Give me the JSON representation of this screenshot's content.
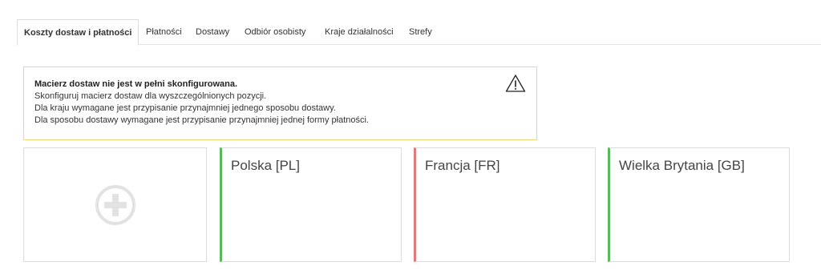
{
  "tabs": [
    {
      "label": "Koszty dostaw i płatności",
      "active": true
    },
    {
      "label": "Płatności"
    },
    {
      "label": "Dostawy"
    },
    {
      "label": "Odbiór osobisty"
    },
    {
      "label": "Kraje działalności"
    },
    {
      "label": "Strefy"
    }
  ],
  "alert": {
    "title": "Macierz dostaw nie jest w pełni skonfigurowana.",
    "lines": [
      "Skonfiguruj macierz dostaw dla wyszczególnionych pozycji.",
      "Dla kraju wymagane jest przypisanie przynajmniej jednego sposobu dostawy.",
      "Dla sposobu dostawy wymagane jest przypisanie przynajmniej jednej formy płatności."
    ],
    "border_color": "#f5d57a",
    "icon": "warning-icon"
  },
  "add_card": {
    "icon": "plus-circle-icon"
  },
  "countries": [
    {
      "name": "Polska [PL]",
      "status_color": "#5cb85c"
    },
    {
      "name": "Francja [FR]",
      "status_color": "#e07b7b"
    },
    {
      "name": "Wielka Brytania [GB]",
      "status_color": "#5cb85c"
    }
  ]
}
